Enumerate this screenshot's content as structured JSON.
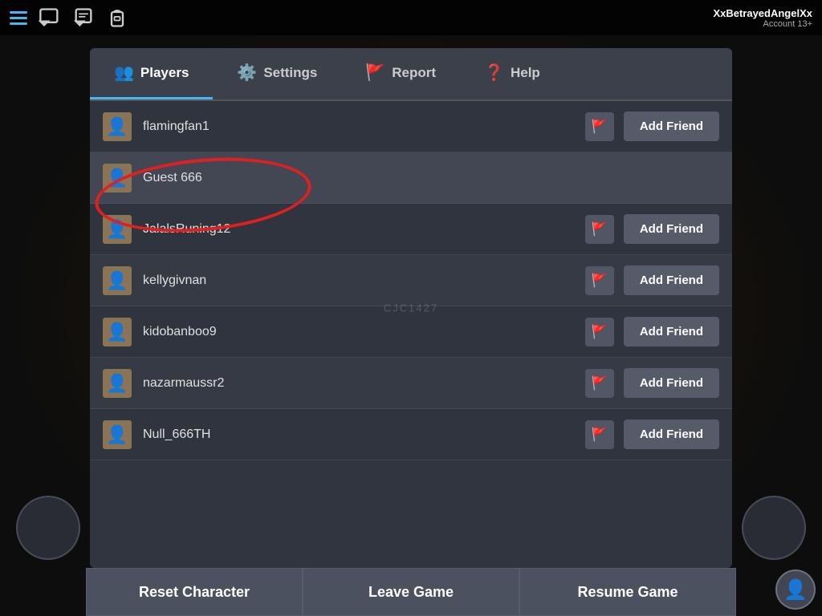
{
  "topBar": {
    "username": "XxBetrayedAngelXx",
    "accountAge": "Account 13+"
  },
  "tabs": [
    {
      "id": "players",
      "label": "Players",
      "icon": "👥",
      "active": true
    },
    {
      "id": "settings",
      "label": "Settings",
      "icon": "⚙️",
      "active": false
    },
    {
      "id": "report",
      "label": "Report",
      "icon": "🚩",
      "active": false
    },
    {
      "id": "help",
      "label": "Help",
      "icon": "❓",
      "active": false
    }
  ],
  "players": [
    {
      "name": "flamingfan1",
      "hasAddFriend": true,
      "hasReport": true,
      "selected": false
    },
    {
      "name": "Guest 666",
      "hasAddFriend": false,
      "hasReport": false,
      "selected": true
    },
    {
      "name": "JalalsRuning12",
      "hasAddFriend": true,
      "hasReport": true,
      "selected": false
    },
    {
      "name": "kellygivnan",
      "hasAddFriend": true,
      "hasReport": true,
      "selected": false
    },
    {
      "name": "kidobanboo9",
      "hasAddFriend": true,
      "hasReport": true,
      "selected": false
    },
    {
      "name": "nazarmaussr2",
      "hasAddFriend": true,
      "hasReport": true,
      "selected": false
    },
    {
      "name": "Null_666TH",
      "hasAddFriend": true,
      "hasReport": true,
      "selected": false
    }
  ],
  "watermark": "CJC1427",
  "buttons": {
    "addFriend": "Add Friend",
    "resetCharacter": "Reset Character",
    "leaveGame": "Leave Game",
    "resumeGame": "Resume Game"
  }
}
